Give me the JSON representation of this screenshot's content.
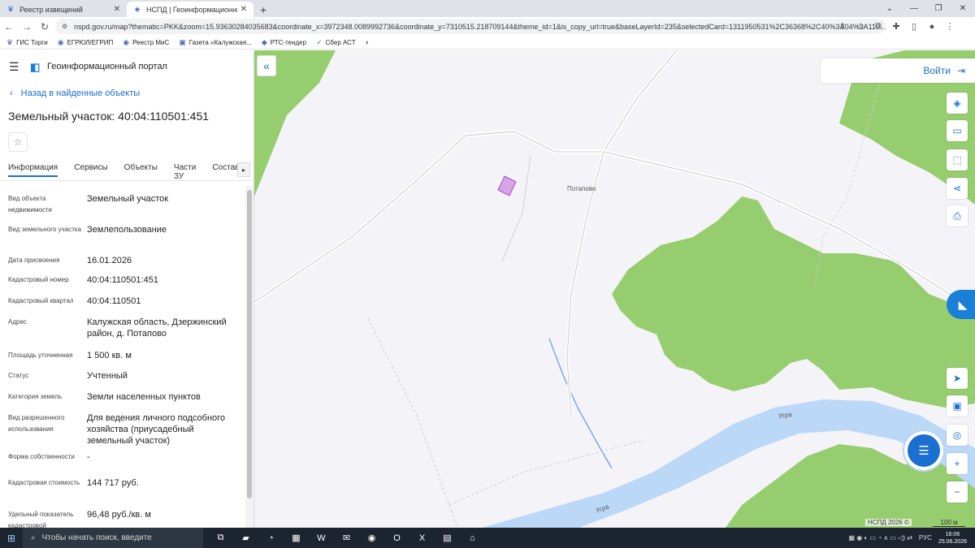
{
  "browser": {
    "tabs": [
      {
        "title": "Реестр извещений",
        "active": false
      },
      {
        "title": "НСПД | Геоинформационный п",
        "active": true
      }
    ],
    "new_tab": "+",
    "url": "nspd.gov.ru/map?thematic=PKK&zoom=15.93630284035683&coordinate_x=3972348.0089992736&coordinate_y=7310515.218709144&theme_id=1&is_copy_url=true&baseLayerId=235&selectedCard=1311950531%2C36368%2C40%3A04%3A110...",
    "bookmarks": [
      "ГИС Торги",
      "ЕГРЮЛ/ЕГРИП",
      "Реестр МиС",
      "Газета «Калужская...",
      "РТС-тендер",
      "Сбер АСТ"
    ]
  },
  "portal": {
    "title": "Геоинформационный портал",
    "back_link": "Назад в найденные объекты",
    "object_title": "Земельный участок: 40:04:110501:451",
    "tabs": [
      "Информация",
      "Сервисы",
      "Объекты",
      "Части ЗУ",
      "Состав"
    ],
    "properties": [
      {
        "key": "Вид объекта недвижимости",
        "value": "Земельный участок"
      },
      {
        "key": "Вид земельного участка",
        "value": "Землепользование"
      },
      {
        "key": "Дата присвоения",
        "value": "16.01.2026"
      },
      {
        "key": "Кадастровый номер",
        "value": "40:04:110501:451"
      },
      {
        "key": "Кадастровый квартал",
        "value": "40:04:110501"
      },
      {
        "key": "Адрес",
        "value": "Калужская область, Дзержинский район, д. Потапово"
      },
      {
        "key": "Площадь уточненная",
        "value": "1 500 кв. м"
      },
      {
        "key": "Статус",
        "value": "Учтенный"
      },
      {
        "key": "Категория земель",
        "value": "Земли населенных пунктов"
      },
      {
        "key": "Вид разрешенного использования",
        "value": "Для ведения личного подсобного хозяйства (приусадебный земельный участок)"
      },
      {
        "key": "Форма собственности",
        "value": "-"
      },
      {
        "key": "Кадастровая стоимость",
        "value": "144 717 руб."
      },
      {
        "key": "Удельный показатель кадастровой",
        "value": "96,48 руб./кв. м"
      }
    ]
  },
  "map": {
    "login": "Войти",
    "labels": {
      "village": "Потапово",
      "river": "Угра"
    },
    "credit": "НСПД 2026 ©",
    "scale": "100 м"
  },
  "taskbar": {
    "search_placeholder": "Чтобы начать поиск, введите",
    "lang": "РУС",
    "time": "16:06",
    "date": "25.06.2026"
  },
  "colors": {
    "accent": "#1a6fd0",
    "forest": "#96cd6e",
    "water": "#bcd8f7",
    "parcel": "#c67ee0"
  }
}
